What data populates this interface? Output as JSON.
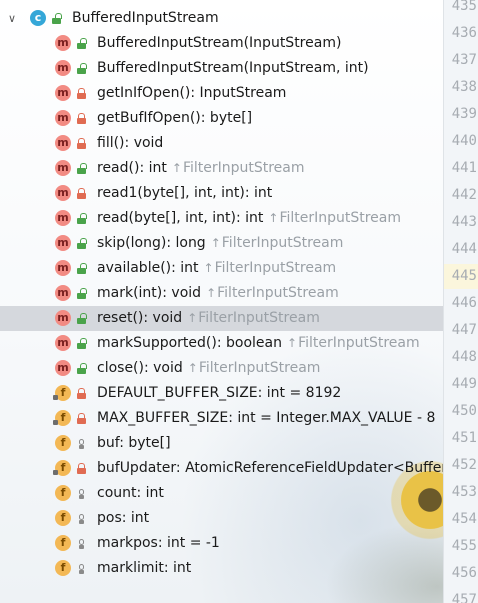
{
  "root": {
    "label": "BufferedInputStream",
    "icon": "class-icon",
    "visibility": "public"
  },
  "items": [
    {
      "kind": "m",
      "vis": "pub",
      "name": "BufferedInputStream(InputStream)"
    },
    {
      "kind": "m",
      "vis": "pub",
      "name": "BufferedInputStream(InputStream, int)"
    },
    {
      "kind": "m",
      "vis": "priv",
      "name": "getInIfOpen(): InputStream"
    },
    {
      "kind": "m",
      "vis": "priv",
      "name": "getBufIfOpen(): byte[]"
    },
    {
      "kind": "m",
      "vis": "priv",
      "name": "fill(): void"
    },
    {
      "kind": "m",
      "vis": "pub",
      "name": "read(): int",
      "inherited": "FilterInputStream"
    },
    {
      "kind": "m",
      "vis": "priv",
      "name": "read1(byte[], int, int): int"
    },
    {
      "kind": "m",
      "vis": "pub",
      "name": "read(byte[], int, int): int",
      "inherited": "FilterInputStream"
    },
    {
      "kind": "m",
      "vis": "pub",
      "name": "skip(long): long",
      "inherited": "FilterInputStream"
    },
    {
      "kind": "m",
      "vis": "pub",
      "name": "available(): int",
      "inherited": "FilterInputStream"
    },
    {
      "kind": "m",
      "vis": "pub",
      "name": "mark(int): void",
      "inherited": "FilterInputStream"
    },
    {
      "kind": "m",
      "vis": "pub",
      "name": "reset(): void",
      "inherited": "FilterInputStream",
      "selected": true
    },
    {
      "kind": "m",
      "vis": "pub",
      "name": "markSupported(): boolean",
      "inherited": "FilterInputStream"
    },
    {
      "kind": "m",
      "vis": "pub",
      "name": "close(): void",
      "inherited": "FilterInputStream"
    },
    {
      "kind": "f",
      "vis": "priv",
      "static": true,
      "name": "DEFAULT_BUFFER_SIZE: int = 8192"
    },
    {
      "kind": "f",
      "vis": "priv",
      "static": true,
      "name": "MAX_BUFFER_SIZE: int = Integer.MAX_VALUE - 8"
    },
    {
      "kind": "f",
      "vis": "pkg",
      "name": "buf: byte[]"
    },
    {
      "kind": "f",
      "vis": "priv",
      "static": true,
      "name": "bufUpdater: AtomicReferenceFieldUpdater<BufferedInputStream, byte[]>"
    },
    {
      "kind": "f",
      "vis": "pkg",
      "name": "count: int"
    },
    {
      "kind": "f",
      "vis": "pkg",
      "name": "pos: int"
    },
    {
      "kind": "f",
      "vis": "pkg",
      "name": "markpos: int = -1"
    },
    {
      "kind": "f",
      "vis": "pkg",
      "name": "marklimit: int"
    }
  ],
  "line_numbers": [
    "435",
    "436",
    "437",
    "438",
    "439",
    "440",
    "441",
    "442",
    "443",
    "444",
    "445",
    "446",
    "447",
    "448",
    "449",
    "450",
    "451",
    "452",
    "453",
    "454",
    "455",
    "456",
    "457"
  ],
  "current_line": "445",
  "colors": {
    "selected_row": "#d5d8dd",
    "inherited_text": "#9aa0a6",
    "method_icon": "#f28b83",
    "field_icon": "#f3b855",
    "class_icon": "#35a7d8"
  }
}
